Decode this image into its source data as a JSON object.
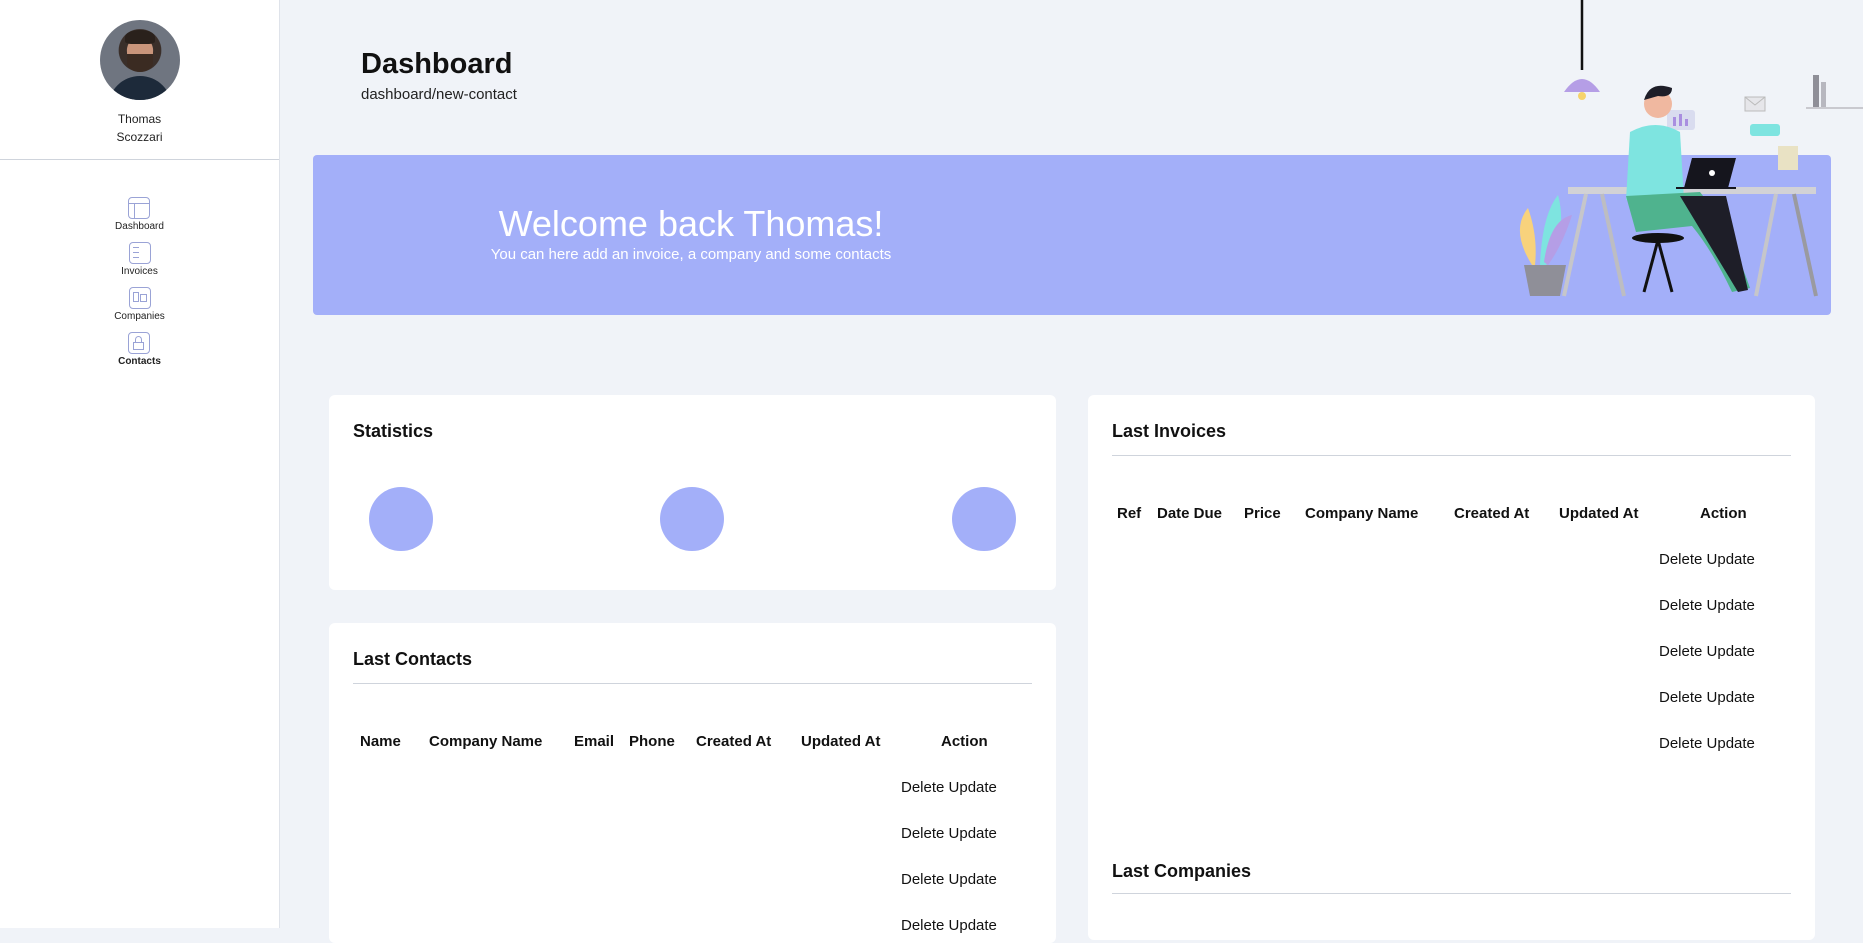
{
  "user": {
    "name": "Thomas Scozzari"
  },
  "nav": [
    {
      "label": "Dashboard",
      "icon": "dashboard-icon"
    },
    {
      "label": "Invoices",
      "icon": "invoice-icon"
    },
    {
      "label": "Companies",
      "icon": "companies-icon"
    },
    {
      "label": "Contacts",
      "icon": "contacts-icon",
      "active": true
    }
  ],
  "header": {
    "title": "Dashboard",
    "breadcrumb": "dashboard/new-contact"
  },
  "banner": {
    "title": "Welcome back Thomas!",
    "subtitle": "You can here add an invoice, a company and some contacts"
  },
  "statistics": {
    "title": "Statistics"
  },
  "contacts": {
    "title": "Last Contacts",
    "columns": [
      "Name",
      "Company Name",
      "Email",
      "Phone",
      "Created At",
      "Updated At",
      "Action"
    ],
    "delete_label": "Delete",
    "update_label": "Update"
  },
  "invoices": {
    "title": "Last Invoices",
    "columns": [
      "Ref",
      "Date Due",
      "Price",
      "Company Name",
      "Created At",
      "Updated At",
      "Action"
    ],
    "delete_label": "Delete",
    "update_label": "Update"
  },
  "companies": {
    "title": "Last Companies"
  },
  "colors": {
    "accent": "#a3aff9",
    "background": "#f0f3f8",
    "card": "#ffffff"
  }
}
